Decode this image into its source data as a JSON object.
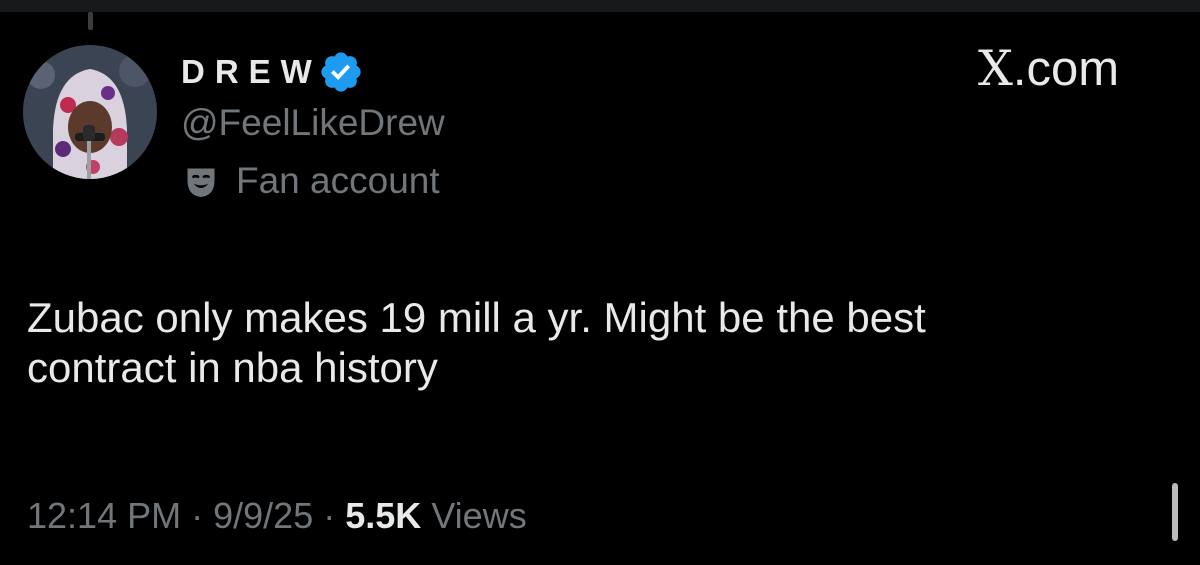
{
  "tweet": {
    "author": {
      "display_name": "DREW",
      "handle": "@FeelLikeDrew",
      "verified": true,
      "affiliation_label": "Fan account",
      "affiliation_icon": "theater-mask-icon"
    },
    "brand_label": "X.com",
    "text_lines": [
      "Zubac only makes 19 mill a yr. Might be the best",
      "contract in nba history"
    ],
    "meta": {
      "time": "12:14 PM",
      "date": "9/9/25",
      "views_count": "5.5K",
      "views_label": "Views",
      "separator": "·"
    }
  },
  "colors": {
    "background": "#000000",
    "primary_text": "#e7e9ea",
    "secondary_text": "#71767b",
    "verified_badge": "#1d9bf0"
  }
}
